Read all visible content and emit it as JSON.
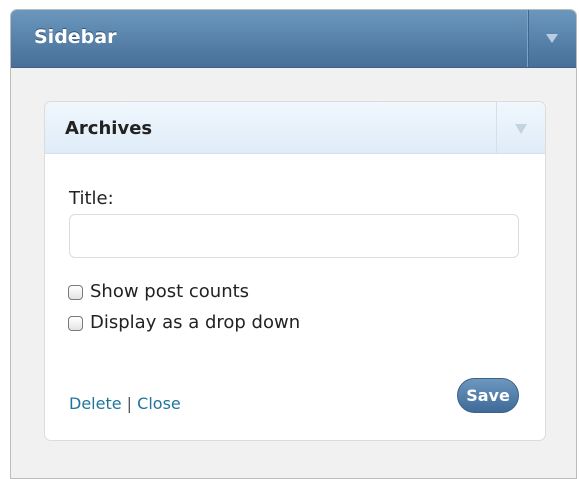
{
  "sidebar": {
    "title": "Sidebar",
    "toggle_icon": "chevron-down-icon"
  },
  "widget": {
    "title": "Archives",
    "toggle_icon": "chevron-down-icon",
    "title_field": {
      "label": "Title:",
      "value": "",
      "placeholder": ""
    },
    "options": [
      {
        "label": "Show post counts",
        "checked": false
      },
      {
        "label": "Display as a drop down",
        "checked": false
      }
    ],
    "actions": {
      "delete_label": "Delete",
      "separator": "|",
      "close_label": "Close",
      "save_label": "Save"
    }
  },
  "colors": {
    "header_blue": "#476f98",
    "link_blue": "#21759b",
    "widget_header": "#dfecf8"
  }
}
